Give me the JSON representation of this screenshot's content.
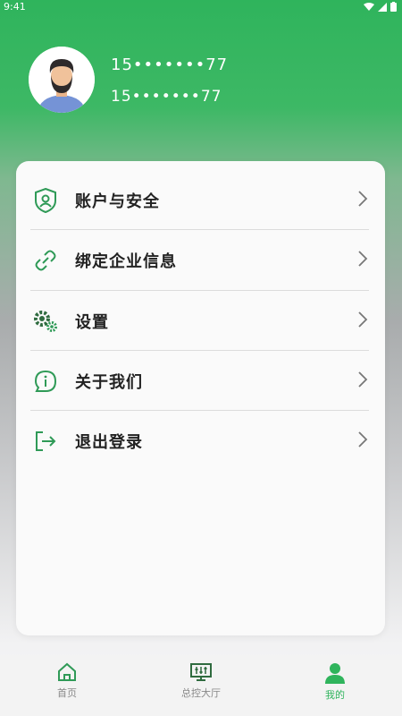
{
  "status": {
    "time": "9:41"
  },
  "profile": {
    "phone_primary": "15•••••••77",
    "phone_secondary": "15•••••••77"
  },
  "menu": {
    "items": [
      {
        "label": "账户与安全",
        "icon": "shield-user-icon"
      },
      {
        "label": "绑定企业信息",
        "icon": "link-icon"
      },
      {
        "label": "设置",
        "icon": "gears-icon"
      },
      {
        "label": "关于我们",
        "icon": "info-bubble-icon"
      },
      {
        "label": "退出登录",
        "icon": "logout-icon"
      }
    ]
  },
  "tabs": [
    {
      "label": "首页",
      "icon": "home-icon",
      "active": false
    },
    {
      "label": "总控大厅",
      "icon": "monitor-control-icon",
      "active": false
    },
    {
      "label": "我的",
      "icon": "user-icon",
      "active": true
    }
  ],
  "colors": {
    "accent": "#2fb45c",
    "icon_green": "#2f9a57"
  }
}
